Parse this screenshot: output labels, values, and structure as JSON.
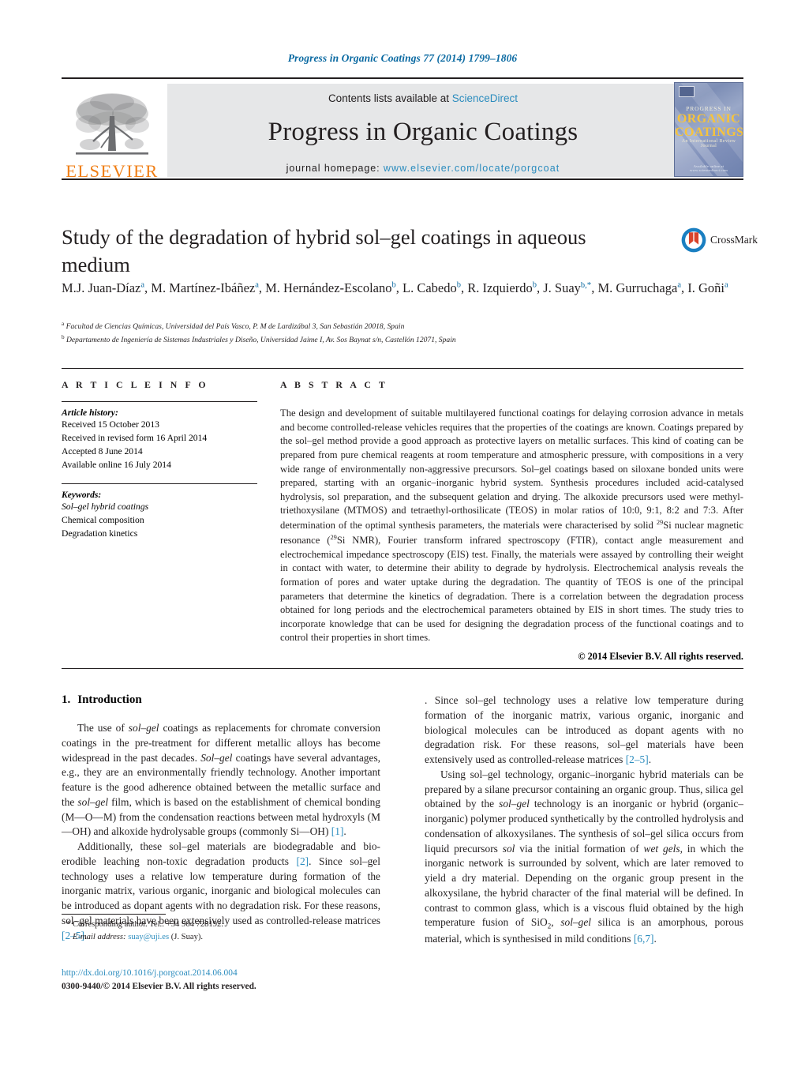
{
  "running_head": "Progress in Organic Coatings 77 (2014) 1799–1806",
  "masthead": {
    "contents_prefix": "Contents lists available at ",
    "sciencedirect": "ScienceDirect",
    "journal_title": "Progress in Organic Coatings",
    "homepage_label": "journal homepage:",
    "homepage_url": "www.elsevier.com/locate/porgcoat",
    "publisher": "ELSEVIER",
    "cover": {
      "line1": "PROGRESS IN",
      "line2": "ORGANIC COATINGS",
      "line3": "An International Review Journal",
      "line4": "Available online at www.sciencedirect.com"
    },
    "accent_blue": "#2b8cbe",
    "elsevier_orange": "#f07f16",
    "band_grey": "#e6e7e8"
  },
  "article": {
    "title": "Study of the degradation of hybrid sol–gel coatings in aqueous medium",
    "crossmark_label": "CrossMark",
    "authors": [
      {
        "name": "M.J. Juan-Díaz",
        "marks": "a",
        "sep": ", "
      },
      {
        "name": "M. Martínez-Ibáñez",
        "marks": "a",
        "sep": ", "
      },
      {
        "name": "M. Hernández-Escolano",
        "marks": "b",
        "sep": ", "
      },
      {
        "name": "L. Cabedo",
        "marks": "b",
        "sep": ", "
      },
      {
        "name": "R. Izquierdo",
        "marks": "b",
        "sep": ", "
      },
      {
        "name": "J. Suay",
        "marks": "b,*",
        "sep": ", "
      },
      {
        "name": "M. Gurruchaga",
        "marks": "a",
        "sep": ", "
      },
      {
        "name": "I. Goñi",
        "marks": "a",
        "sep": ""
      }
    ],
    "affiliations": [
      {
        "mark": "a",
        "text": "Facultad de Ciencias Químicas, Universidad del País Vasco, P. M de Lardizábal 3, San Sebastián 20018, Spain"
      },
      {
        "mark": "b",
        "text": "Departamento de Ingeniería de Sistemas Industriales y Diseño, Universidad Jaime I, Av. Sos Baynat s/n, Castellón 12071, Spain"
      }
    ]
  },
  "article_info": {
    "heading": "A R T I C L E   I N F O",
    "history_title": "Article history:",
    "history": [
      "Received 15 October 2013",
      "Received in revised form 16 April 2014",
      "Accepted 8 June 2014",
      "Available online 16 July 2014"
    ],
    "keywords_title": "Keywords:",
    "keywords": [
      "Sol–gel hybrid coatings",
      "Chemical composition",
      "Degradation kinetics"
    ]
  },
  "abstract": {
    "heading": "A B S T R A C T",
    "text": "The design and development of suitable multilayered functional coatings for delaying corrosion advance in metals and become controlled-release vehicles requires that the properties of the coatings are known. Coatings prepared by the sol–gel method provide a good approach as protective layers on metallic surfaces. This kind of coating can be prepared from pure chemical reagents at room temperature and atmospheric pressure, with compositions in a very wide range of environmentally non-aggressive precursors. Sol–gel coatings based on siloxane bonded units were prepared, starting with an organic–inorganic hybrid system. Synthesis procedures included acid-catalysed hydrolysis, sol preparation, and the subsequent gelation and drying. The alkoxide precursors used were methyl-triethoxysilane (MTMOS) and tetraethyl-orthosilicate (TEOS) in molar ratios of 10:0, 9:1, 8:2 and 7:3. After determination of the optimal synthesis parameters, the materials were characterised by solid ",
    "sup1": "29",
    "text2": "Si nuclear magnetic resonance (",
    "sup2": "29",
    "text3": "Si NMR), Fourier transform infrared spectroscopy (FTIR), contact angle measurement and electrochemical impedance spectroscopy (EIS) test. Finally, the materials were assayed by controlling their weight in contact with water, to determine their ability to degrade by hydrolysis. Electrochemical analysis reveals the formation of pores and water uptake during the degradation. The quantity of TEOS is one of the principal parameters that determine the kinetics of degradation. There is a correlation between the degradation process obtained for long periods and the electrochemical parameters obtained by EIS in short times. The study tries to incorporate knowledge that can be used for designing the degradation process of the functional coatings and to control their properties in short times.",
    "copyright": "© 2014 Elsevier B.V. All rights reserved."
  },
  "introduction": {
    "number": "1.",
    "title": "Introduction",
    "p1_a": "The use of ",
    "p1_i1": "sol–gel",
    "p1_b": " coatings as replacements for chromate conversion coatings in the pre-treatment for different metallic alloys has become widespread in the past decades. ",
    "p1_i2": "Sol–gel",
    "p1_c": " coatings have several advantages, e.g., they are an environmentally friendly technology. Another important feature is the good adherence obtained between the metallic surface and the ",
    "p1_i3": "sol–gel",
    "p1_d": " film, which is based on the establishment of chemical bonding (M—O—M) from the condensation reactions between metal hydroxyls (M—OH) and alkoxide hydrolysable groups (commonly Si—OH) ",
    "p1_ref": "[1]",
    "p1_e": ".",
    "p2_a": "Additionally, these sol–gel materials are biodegradable and bio-erodible leaching non-toxic degradation products ",
    "p2_ref": "[2]",
    "p2_b": ". Since sol–gel technology uses a relative low temperature during formation of the inorganic matrix, various organic, inorganic and biological molecules can be introduced as dopant agents with no degradation risk. For these reasons, sol–gel materials have been extensively used as controlled-release matrices ",
    "p2_ref2": "[2–5]",
    "p2_c": ".",
    "p3_a": "Using sol–gel technology, organic–inorganic hybrid materials can be prepared by a silane precursor containing an organic group. Thus, silica gel obtained by the ",
    "p3_i1": "sol–gel",
    "p3_b": " technology is an inorganic or hybrid (organic–inorganic) polymer produced synthetically by the controlled hydrolysis and condensation of alkoxysilanes. The synthesis of sol–gel silica occurs from liquid precursors ",
    "p3_i2": "sol",
    "p3_c": " via the initial formation of ",
    "p3_i3": "wet gels",
    "p3_d": ", in which the inorganic network is surrounded by solvent, which are later removed to yield a dry material. Depending on the organic group present in the alkoxysilane, the hybrid character of the final material will be defined. In contrast to common glass, which is a viscous fluid obtained by the high temperature fusion of SiO",
    "p3_sub": "2",
    "p3_e": ", ",
    "p3_i4": "sol–gel",
    "p3_f": " silica is an amorphous, porous material, which is synthesised in mild conditions ",
    "p3_ref": "[6,7]",
    "p3_g": "."
  },
  "footer": {
    "corresponding_mark": "*",
    "corresponding_text": "Corresponding author. Tel.: +34 964 728192.",
    "email_label": "E-mail address:",
    "email": "suay@uji.es",
    "email_owner": "(J. Suay).",
    "doi": "http://dx.doi.org/10.1016/j.porgcoat.2014.06.004",
    "issn_line": "0300-9440/© 2014 Elsevier B.V. All rights reserved."
  }
}
